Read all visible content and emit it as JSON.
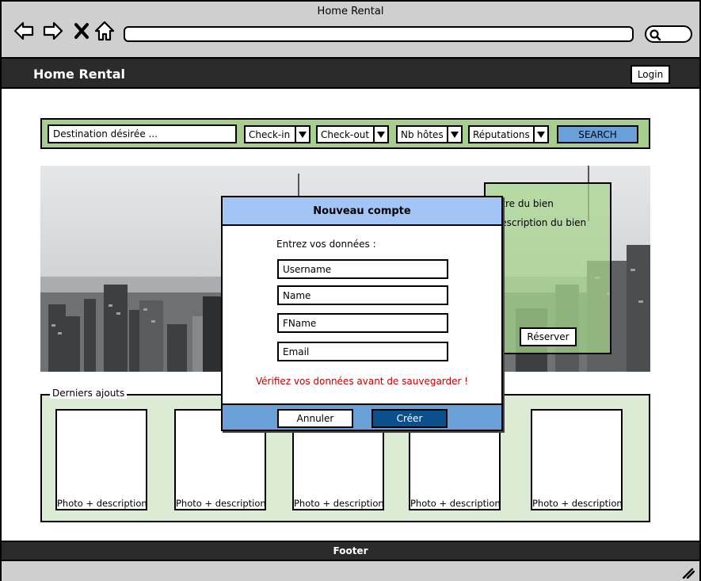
{
  "window": {
    "title": "Home Rental"
  },
  "appbar": {
    "brand": "Home Rental",
    "login_label": "Login"
  },
  "search": {
    "destination_placeholder": "Destination désirée ...",
    "checkin_label": "Check-in",
    "checkout_label": "Check-out",
    "guests_label": "Nb hôtes",
    "reputation_label": "Réputations",
    "search_label": "SEARCH"
  },
  "hero": {
    "card_title": "Titre du bien",
    "card_description": "Description du bien",
    "reserve_label": "Réserver"
  },
  "recent": {
    "legend": "Derniers ajouts",
    "cards": [
      {
        "label": "Photo + description"
      },
      {
        "label": "Photo + description"
      },
      {
        "label": "Photo + description"
      },
      {
        "label": "Photo + description"
      },
      {
        "label": "Photo + description"
      }
    ]
  },
  "footer": {
    "label": "Footer"
  },
  "modal": {
    "title": "Nouveau compte",
    "intro": "Entrez vos données :",
    "fields": [
      {
        "placeholder": "Username"
      },
      {
        "placeholder": "Name"
      },
      {
        "placeholder": "FName"
      },
      {
        "placeholder": "Email"
      }
    ],
    "warning": "Vérifiez vos données avant de sauvegarder !",
    "cancel_label": "Annuler",
    "create_label": "Créer"
  },
  "colors": {
    "search_strip": "#a6cf8e",
    "search_button": "#6a9fd8",
    "modal_header": "#a3c5f5",
    "modal_footer": "#6a9fd8",
    "create_button": "#0b4f8c",
    "warning_text": "#c00000",
    "dark_bar": "#2b2b2b"
  },
  "icons": [
    "back-arrow-icon",
    "forward-arrow-icon",
    "close-icon",
    "home-icon",
    "search-icon",
    "resize-grip-icon",
    "dropdown-arrow-icon"
  ]
}
